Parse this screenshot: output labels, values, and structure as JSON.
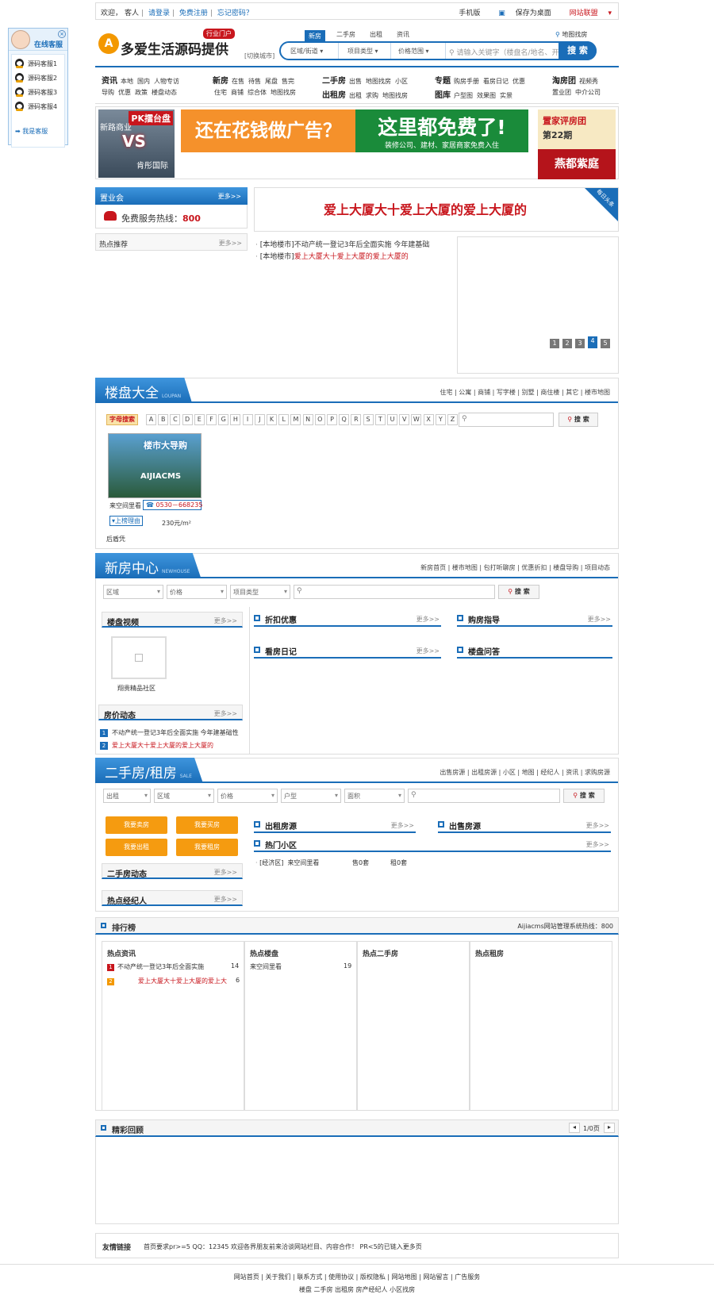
{
  "topbar": {
    "welcome": "欢迎，",
    "guest": "客人",
    "sep": "|",
    "login": "请登录",
    "register": "免费注册",
    "forgot": "忘记密码？",
    "mobile": "手机版",
    "save_desktop": "保存为桌面",
    "union": "网站联盟"
  },
  "float_service": {
    "title": "在线客服",
    "items": [
      "源码客服1",
      "源码客服2",
      "源码客服3",
      "源码客服4"
    ],
    "me": "我是客服"
  },
  "logo": {
    "mark": "A",
    "text": "多爱生活源码提供",
    "badge": "行业门户",
    "switch_city": "[切换城市]"
  },
  "search": {
    "tabs": [
      "新房",
      "二手房",
      "出租",
      "资讯"
    ],
    "active": "新房",
    "selects": [
      "区域/街道",
      "项目类型",
      "价格范围"
    ],
    "placeholder": "请输入关键字（楼盘名/地名、开发商等）",
    "button": "搜 索",
    "map": "地图找房"
  },
  "nav": {
    "zixun": {
      "head": "资讯",
      "row1": [
        "本地",
        "国内",
        "人物专访"
      ],
      "row2": [
        "导购",
        "优惠",
        "政策",
        "楼盘动态"
      ]
    },
    "xinfang": {
      "head": "新房",
      "row1": [
        "在售",
        "待售",
        "尾盘",
        "售完"
      ],
      "row2": [
        "住宅",
        "商铺",
        "综合体",
        "地图找房"
      ]
    },
    "ershou": {
      "head": "二手房",
      "row1": [
        "出售",
        "地图找房",
        "小区"
      ]
    },
    "chuzu": {
      "head": "出租房",
      "row1": [
        "出租",
        "求购",
        "地图找房"
      ]
    },
    "zhuanti": {
      "head": "专题",
      "row1": [
        "购房手册",
        "看房日记",
        "优惠"
      ]
    },
    "tuku": {
      "head": "图库",
      "row1": [
        "户型图",
        "效果图",
        "实景"
      ]
    },
    "taofang": {
      "head": "淘房团",
      "row1": [
        "视频秀"
      ],
      "row2": [
        "置业团",
        "中介公司"
      ]
    }
  },
  "banners": {
    "pk": {
      "badge": "PK擂台盘",
      "top": "新路商业",
      "vs": "VS",
      "bottom": "肯彤国际"
    },
    "ad1": "还在花钱做广告？",
    "ad2_title": "这里都免费了!",
    "ad2_sub": "装修公司、建材、家居商家免费入住",
    "yd1": "置家评房团",
    "yd2": "第22期",
    "yd3": "燕都紫庭"
  },
  "zhiyehui": {
    "title": "置业会",
    "more": "更多>>",
    "hotline_label": "免费服务热线：",
    "hotline": "800"
  },
  "hot": {
    "title": "热点推荐",
    "more": "更多>>"
  },
  "headline": {
    "title": "爱上大厦大十爱上大厦的爱上大厦的",
    "corner": "每日头条"
  },
  "news": [
    {
      "tag": "[本地楼市]",
      "text": "不动产统一登记3年后全面实施 今年建基础",
      "color": "#333"
    },
    {
      "tag": "[本地楼市]",
      "text": "爱上大厦大十爱上大厦的爱上大厦的",
      "color": "#c8161d"
    }
  ],
  "slider_pages": [
    "1",
    "2",
    "3",
    "4",
    "5"
  ],
  "loupan": {
    "title": "楼盘大全",
    "en": "LOUPAN",
    "links": "住宅 | 公寓 | 商铺 | 写字楼 | 别墅 | 商住楼 | 其它 | 楼市地图",
    "letter_label": "字母搜索",
    "letters": [
      "A",
      "B",
      "C",
      "D",
      "E",
      "F",
      "G",
      "H",
      "I",
      "J",
      "K",
      "L",
      "M",
      "N",
      "O",
      "P",
      "Q",
      "R",
      "S",
      "T",
      "U",
      "V",
      "W",
      "X",
      "Y",
      "Z"
    ],
    "search": "搜 索",
    "card": {
      "img_title": "楼市大导购",
      "img_brand": "AIJIACMS",
      "name": "来空间里看",
      "phone": "0530－668235",
      "tag": "▾上榜理由",
      "price": "230元/m²",
      "extra": "后盾凭"
    }
  },
  "xinfang_center": {
    "title": "新房中心",
    "en": "NEWHOUSE",
    "links": "新房首页 | 楼市地图 | 包打听聊房 | 优惠折扣 | 楼盘导购 | 项目动态",
    "selects": [
      "区域",
      "价格",
      "项目类型"
    ],
    "search": "搜 索",
    "video": {
      "title": "楼盘视频",
      "more": "更多>>",
      "name": "翔贵精品社区"
    },
    "price": {
      "title": "房价动态",
      "more": "更多>>",
      "items": [
        {
          "n": "1",
          "text": "不动产统一登记3年后全面实施 今年建基础性",
          "color": "#333"
        },
        {
          "n": "2",
          "text": "爱上大厦大十爱上大厦的爱上大厦的",
          "color": "#c8161d"
        }
      ]
    },
    "subs": [
      {
        "t": "折扣优惠",
        "m": "更多>>"
      },
      {
        "t": "购房指导",
        "m": "更多>>"
      },
      {
        "t": "看房日记",
        "m": "更多>>"
      },
      {
        "t": "楼盘问答",
        "m": ""
      }
    ]
  },
  "ershou_center": {
    "title": "二手房/租房",
    "en": "SALE",
    "links": "出售房源 | 出租房源 | 小区 | 地图 | 经纪人 | 资讯 | 求购房源",
    "selects": [
      "出租",
      "区域",
      "价格",
      "户型",
      "面积"
    ],
    "search": "搜 索",
    "buttons": [
      "我要卖房",
      "我要买房",
      "我要出租",
      "我要租房"
    ],
    "dongtai": {
      "title": "二手房动态",
      "more": "更多>>"
    },
    "agent": {
      "title": "热点经纪人",
      "more": "更多>>"
    },
    "subs": [
      {
        "t": "出租房源",
        "m": "更多>>"
      },
      {
        "t": "出售房源",
        "m": "更多>>"
      },
      {
        "t": "热门小区",
        "m": "更多>>"
      }
    ],
    "community": {
      "zone": "[经济区]",
      "name": "来空间里看",
      "sale": "售0套",
      "rent": "租0套"
    }
  },
  "ranking": {
    "title": "排行榜",
    "hotline": "Aijiacms网站管理系统热线：800",
    "cols": [
      {
        "title": "热点资讯",
        "items": [
          {
            "n": "1",
            "text": "不动产统一登记3年后全面实施",
            "count": "14",
            "color": "#333"
          },
          {
            "n": "2",
            "text": "爱上大厦大十爱上大厦的爱上大",
            "count": "6",
            "color": "#c8161d"
          }
        ]
      },
      {
        "title": "热点楼盘",
        "items": [
          {
            "n": "",
            "text": "来空间里看",
            "count": "19",
            "color": "#333"
          }
        ]
      },
      {
        "title": "热点二手房",
        "items": []
      },
      {
        "title": "热点租房",
        "items": []
      }
    ]
  },
  "review": {
    "title": "精彩回顾",
    "page": "1/0页",
    "prev": "◂",
    "next": "▸"
  },
  "friends": {
    "title": "友情链接",
    "text": "首页要求pr>=5 QQ：12345 欢迎各界朋友前来洽谈网站栏目、内容合作！ PR<5的已链入更多页"
  },
  "footer": {
    "line1": "网站首页  |  关于我们  |  联系方式  |  使用协议  |  版权隐私  |  网站地图  |  网站留言  |  广告服务",
    "line2": "楼盘    二手房    出租房    房产经纪人    小区找房"
  }
}
